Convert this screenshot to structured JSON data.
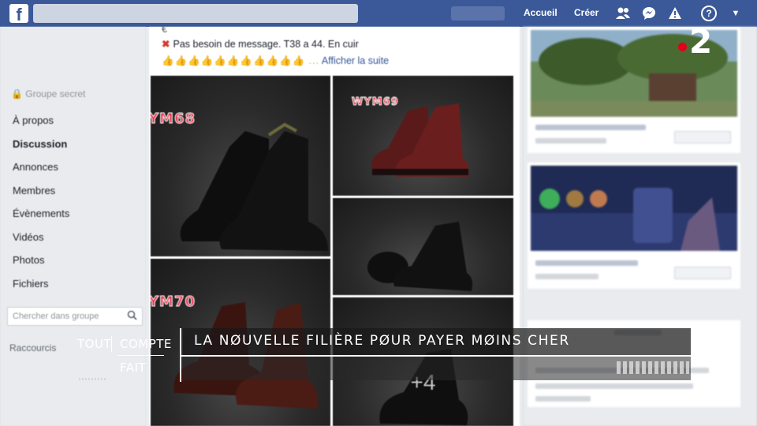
{
  "topbar": {
    "logo": "f",
    "home": "Accueil",
    "create": "Créer",
    "icons": [
      "friends-icon",
      "messenger-icon",
      "notifications-icon",
      "help-icon",
      "menu-caret-icon"
    ],
    "brand_color": "#3b5998"
  },
  "sidebar": {
    "group_type": "Groupe secret",
    "items": [
      "À propos",
      "Discussion",
      "Annonces",
      "Membres",
      "Évènements",
      "Vidéos",
      "Photos",
      "Fichiers"
    ],
    "active": "Discussion",
    "search_placeholder": "Chercher dans groupe",
    "shortcuts": "Raccourcis"
  },
  "post": {
    "line_price": "€",
    "line_message": "Pas besoin de message. T38 a 44. En cuir",
    "emoji_row": "👍👍👍👍👍👍👍👍👍👍👍 ...",
    "see_more": "Afficher la suite",
    "photos": [
      {
        "label": "YM68"
      },
      {
        "label": "WYM69"
      },
      {
        "label": ""
      },
      {
        "label": "YM70"
      },
      {
        "label": ""
      }
    ],
    "more_photos": "+4"
  },
  "channel": {
    "number": "2",
    "accent": "#e2001a"
  },
  "banner": {
    "tout": "TOUT",
    "compte": "COMPTE",
    "fait": "FAIT",
    "headline": "LA NØUVELLE FILIÈRE PØUR PAYER MØINS CHER"
  }
}
